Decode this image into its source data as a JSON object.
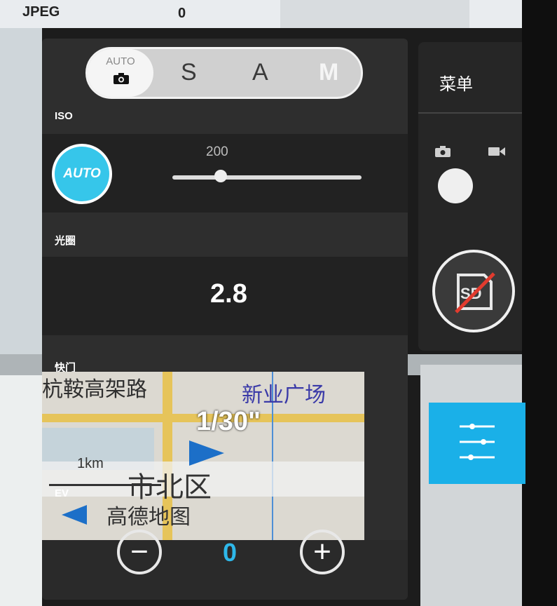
{
  "background": {
    "top_label": "JPEG",
    "top_value": "0"
  },
  "mode_selector": {
    "auto_label": "AUTO",
    "modes": [
      "S",
      "A",
      "M"
    ],
    "selected": "M"
  },
  "iso": {
    "label": "ISO",
    "auto_button": "AUTO",
    "value": "200",
    "slider_position": 0.25
  },
  "aperture": {
    "label": "光圈",
    "value": "2.8"
  },
  "shutter": {
    "label": "快门",
    "value": "1/30\""
  },
  "ev": {
    "label": "EV",
    "minus": "−",
    "value": "0",
    "plus": "+"
  },
  "map_overlay": {
    "road_name": "杭鞍高架路",
    "plaza": "新业广场",
    "scale": "1km",
    "district": "市北区",
    "brand": "高德地图"
  },
  "side_menu": {
    "title": "菜单",
    "photo_icon": "camera-icon",
    "video_icon": "video-icon",
    "sd_status": "SD",
    "settings_icon": "sliders-icon"
  },
  "colors": {
    "accent": "#36c6ea",
    "panel": "#2e2e2e",
    "settings_button": "#1ab0e8"
  }
}
